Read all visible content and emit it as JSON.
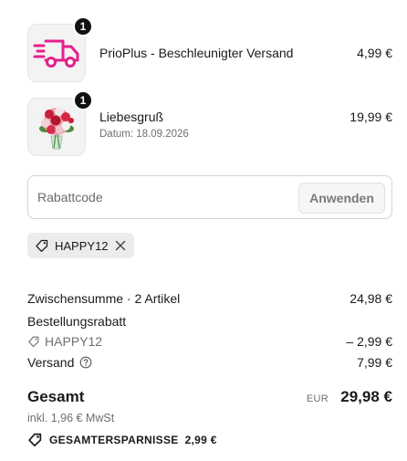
{
  "items": [
    {
      "quantity": "1",
      "title": "PrioPlus - Beschleunigter Versand",
      "price": "4,99 €",
      "icon": "delivery-truck-icon",
      "icon_color": "#e6208c"
    },
    {
      "quantity": "1",
      "title": "Liebesgruß",
      "subtitle": "Datum: 18.09.2026",
      "price": "19,99 €",
      "image": "flower-bouquet-image"
    }
  ],
  "discount": {
    "placeholder": "Rabattcode",
    "apply_label": "Anwenden"
  },
  "applied_code": {
    "code": "HAPPY12",
    "icon": "tag-icon",
    "remove_icon": "close-icon"
  },
  "summary": {
    "subtotal_label": "Zwischensumme · 2 Artikel",
    "subtotal_value": "24,98 €",
    "order_discount_label": "Bestellungsrabatt",
    "order_discount_code": "HAPPY12",
    "order_discount_value": "– 2,99 €",
    "shipping_label": "Versand",
    "shipping_value": "7,99 €",
    "total_label": "Gesamt",
    "currency": "EUR",
    "total_value": "29,98 €",
    "tax_note": "inkl. 1,96 € MwSt",
    "savings_label": "GESAMTERSPARNISSE",
    "savings_value": "2,99 €"
  },
  "colors": {
    "badge": "#111111",
    "accent_pink": "#e6208c"
  }
}
